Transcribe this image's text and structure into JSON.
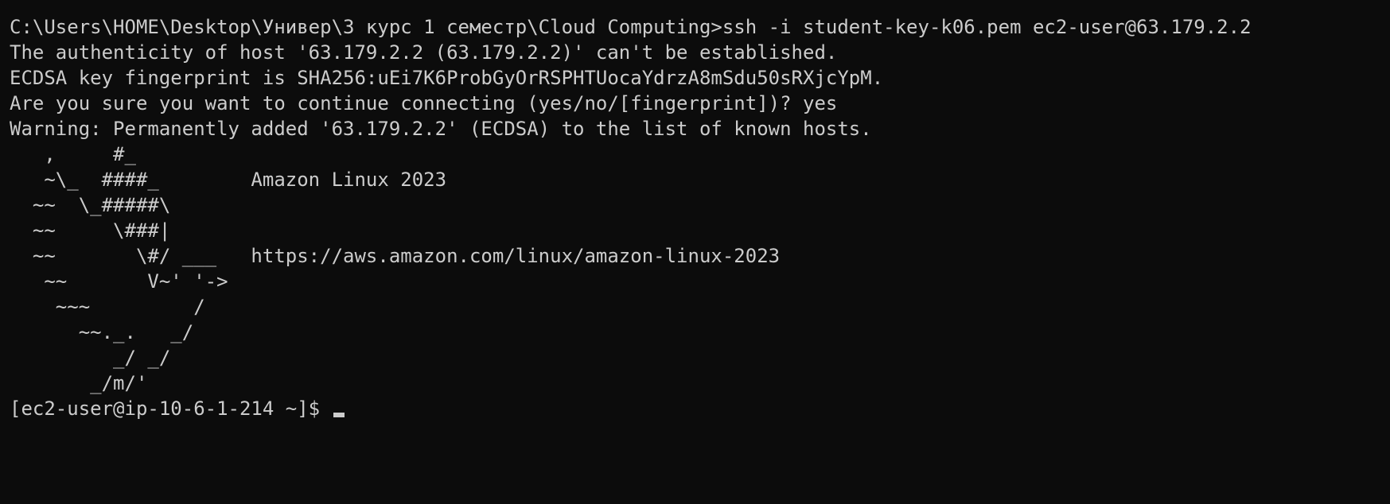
{
  "terminal": {
    "lines": [
      "C:\\Users\\HOME\\Desktop\\Универ\\3 курс 1 семестр\\Cloud Computing>ssh -i student-key-k06.pem ec2-user@63.179.2.2",
      "The authenticity of host '63.179.2.2 (63.179.2.2)' can't be established.",
      "ECDSA key fingerprint is SHA256:uEi7K6ProbGyOrRSPHTUocaYdrzA8mSdu50sRXjcYpM.",
      "Are you sure you want to continue connecting (yes/no/[fingerprint])? yes",
      "Warning: Permanently added '63.179.2.2' (ECDSA) to the list of known hosts.",
      "   ,     #_",
      "   ~\\_  ####_        Amazon Linux 2023",
      "  ~~  \\_#####\\",
      "  ~~     \\###|",
      "  ~~       \\#/ ___   https://aws.amazon.com/linux/amazon-linux-2023",
      "   ~~       V~' '->",
      "    ~~~         /",
      "      ~~._.   _/",
      "         _/ _/",
      "       _/m/'"
    ],
    "prompt": "[ec2-user@ip-10-6-1-214 ~]$ "
  },
  "colors": {
    "background": "#0c0c0c",
    "foreground": "#cccccc"
  }
}
